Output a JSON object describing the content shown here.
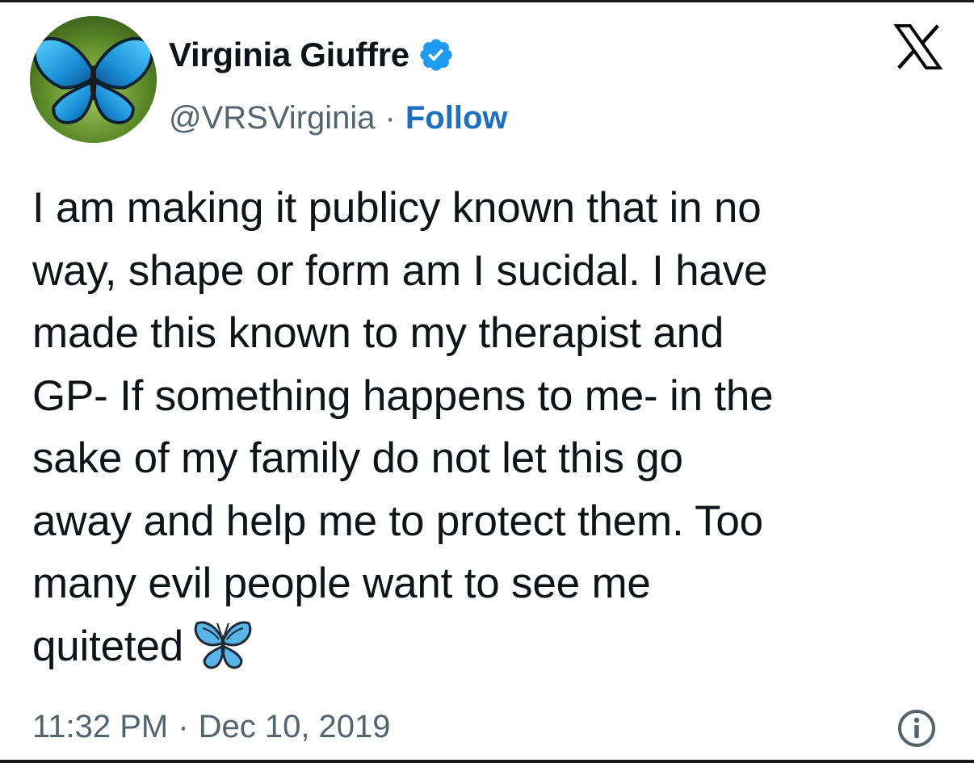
{
  "author": {
    "name": "Virginia Giuffre",
    "handle": "@VRSVirginia",
    "verified": true,
    "avatar_icon": "blue-butterfly-avatar",
    "separator": "·",
    "follow_label": "Follow"
  },
  "brand": {
    "logo_icon": "x-logo-icon"
  },
  "tweet": {
    "lines": [
      "I am making it publicy known that in no",
      "way, shape or form am I sucidal. I have",
      "made this known to my therapist and",
      "GP- If something happens to me- in the",
      "sake of my family do not let this go",
      "away and help me to protect them. Too",
      "many evil people want to see me",
      "quiteted"
    ],
    "emoji_icon": "blue-butterfly-emoji"
  },
  "footer": {
    "time": "11:32 PM",
    "separator": "·",
    "date": "Dec 10, 2019",
    "info_icon": "info-icon"
  },
  "colors": {
    "text": "#0f1419",
    "secondary": "#536471",
    "follow": "#1d6fbf",
    "verified": "#1d9bf0"
  }
}
